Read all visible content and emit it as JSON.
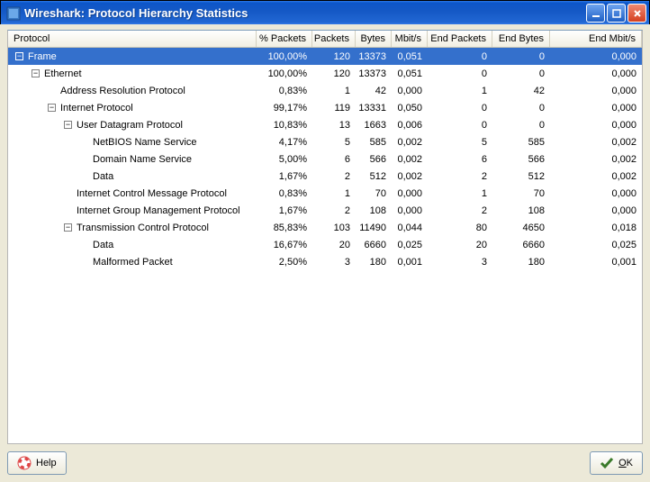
{
  "window": {
    "title": "Wireshark: Protocol Hierarchy Statistics"
  },
  "headers": {
    "protocol": "Protocol",
    "pct": "% Packets",
    "pkt": "Packets",
    "bytes": "Bytes",
    "mbit": "Mbit/s",
    "endpkt": "End Packets",
    "endbytes": "End Bytes",
    "endmbit": "End Mbit/s"
  },
  "rows": [
    {
      "indent": 0,
      "toggle": "-",
      "name": "Frame",
      "pct": "100,00%",
      "pkt": "120",
      "bytes": "13373",
      "mbit": "0,051",
      "endpkt": "0",
      "endbytes": "0",
      "endmbit": "0,000",
      "selected": true
    },
    {
      "indent": 1,
      "toggle": "-",
      "name": "Ethernet",
      "pct": "100,00%",
      "pkt": "120",
      "bytes": "13373",
      "mbit": "0,051",
      "endpkt": "0",
      "endbytes": "0",
      "endmbit": "0,000"
    },
    {
      "indent": 2,
      "toggle": "",
      "name": "Address Resolution Protocol",
      "pct": "0,83%",
      "pkt": "1",
      "bytes": "42",
      "mbit": "0,000",
      "endpkt": "1",
      "endbytes": "42",
      "endmbit": "0,000"
    },
    {
      "indent": 2,
      "toggle": "-",
      "name": "Internet Protocol",
      "pct": "99,17%",
      "pkt": "119",
      "bytes": "13331",
      "mbit": "0,050",
      "endpkt": "0",
      "endbytes": "0",
      "endmbit": "0,000"
    },
    {
      "indent": 3,
      "toggle": "-",
      "name": "User Datagram Protocol",
      "pct": "10,83%",
      "pkt": "13",
      "bytes": "1663",
      "mbit": "0,006",
      "endpkt": "0",
      "endbytes": "0",
      "endmbit": "0,000"
    },
    {
      "indent": 4,
      "toggle": "",
      "name": "NetBIOS Name Service",
      "pct": "4,17%",
      "pkt": "5",
      "bytes": "585",
      "mbit": "0,002",
      "endpkt": "5",
      "endbytes": "585",
      "endmbit": "0,002"
    },
    {
      "indent": 4,
      "toggle": "",
      "name": "Domain Name Service",
      "pct": "5,00%",
      "pkt": "6",
      "bytes": "566",
      "mbit": "0,002",
      "endpkt": "6",
      "endbytes": "566",
      "endmbit": "0,002"
    },
    {
      "indent": 4,
      "toggle": "",
      "name": "Data",
      "pct": "1,67%",
      "pkt": "2",
      "bytes": "512",
      "mbit": "0,002",
      "endpkt": "2",
      "endbytes": "512",
      "endmbit": "0,002"
    },
    {
      "indent": 3,
      "toggle": "",
      "name": "Internet Control Message Protocol",
      "pct": "0,83%",
      "pkt": "1",
      "bytes": "70",
      "mbit": "0,000",
      "endpkt": "1",
      "endbytes": "70",
      "endmbit": "0,000"
    },
    {
      "indent": 3,
      "toggle": "",
      "name": "Internet Group Management Protocol",
      "pct": "1,67%",
      "pkt": "2",
      "bytes": "108",
      "mbit": "0,000",
      "endpkt": "2",
      "endbytes": "108",
      "endmbit": "0,000"
    },
    {
      "indent": 3,
      "toggle": "-",
      "name": "Transmission Control Protocol",
      "pct": "85,83%",
      "pkt": "103",
      "bytes": "11490",
      "mbit": "0,044",
      "endpkt": "80",
      "endbytes": "4650",
      "endmbit": "0,018"
    },
    {
      "indent": 4,
      "toggle": "",
      "name": "Data",
      "pct": "16,67%",
      "pkt": "20",
      "bytes": "6660",
      "mbit": "0,025",
      "endpkt": "20",
      "endbytes": "6660",
      "endmbit": "0,025"
    },
    {
      "indent": 4,
      "toggle": "",
      "name": "Malformed Packet",
      "pct": "2,50%",
      "pkt": "3",
      "bytes": "180",
      "mbit": "0,001",
      "endpkt": "3",
      "endbytes": "180",
      "endmbit": "0,001"
    }
  ],
  "buttons": {
    "help": "Help",
    "ok": "OK"
  }
}
